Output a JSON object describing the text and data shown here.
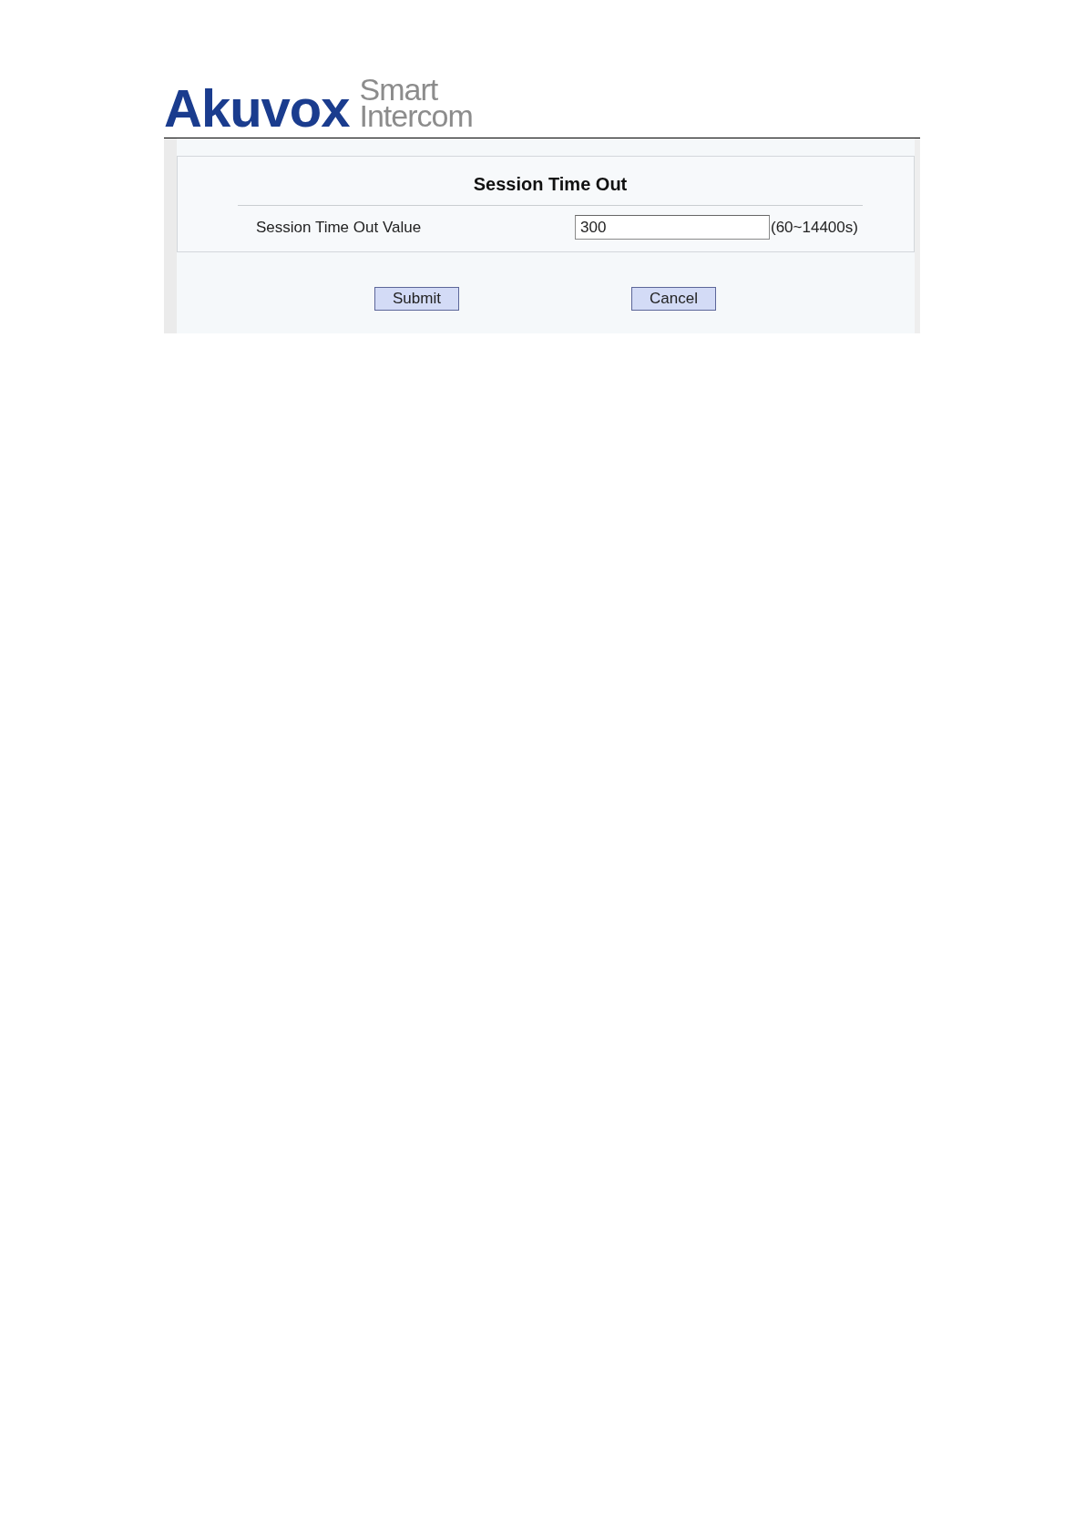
{
  "logo": {
    "brand": "Akuvox",
    "tagline": [
      "Smart",
      "Intercom"
    ]
  },
  "panel": {
    "title": "Session Time Out",
    "fields": [
      {
        "label": "Session Time Out Value",
        "value": "300",
        "hint": "(60~14400s)"
      }
    ]
  },
  "buttons": [
    "Submit",
    "Cancel"
  ]
}
